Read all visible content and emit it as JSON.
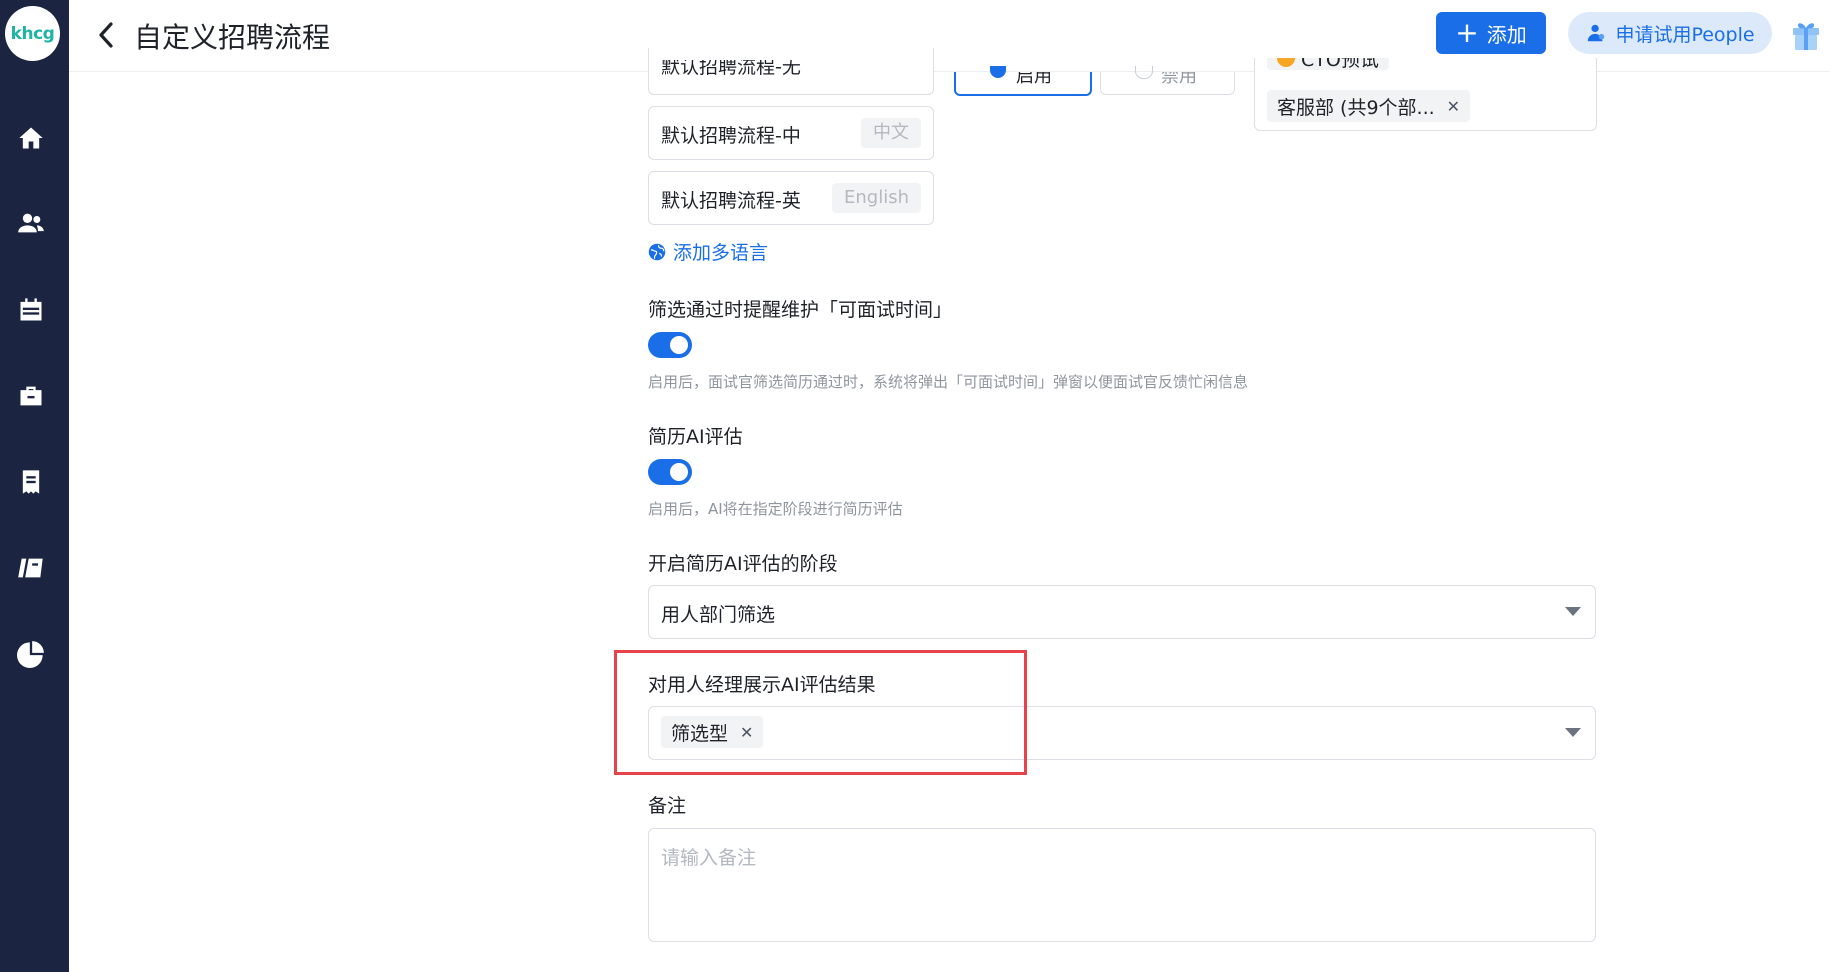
{
  "app": {
    "logo_text": "khcg"
  },
  "sidebar": {
    "items": [
      {
        "name": "home",
        "icon": "home-icon"
      },
      {
        "name": "people",
        "icon": "people-icon"
      },
      {
        "name": "calendar",
        "icon": "calendar-icon"
      },
      {
        "name": "jobs",
        "icon": "briefcase-icon"
      },
      {
        "name": "documents",
        "icon": "document-icon"
      },
      {
        "name": "library",
        "icon": "library-icon"
      },
      {
        "name": "reports",
        "icon": "pie-chart-icon"
      }
    ]
  },
  "header": {
    "title": "自定义招聘流程",
    "add_label": "添加",
    "trial_label": "申请试用People"
  },
  "process": {
    "cut_top_label": "默认招聘流程-无",
    "languages": [
      {
        "name": "默认招聘流程-中",
        "tag": "中文"
      },
      {
        "name": "默认招聘流程-英",
        "tag": "English"
      }
    ],
    "add_language_label": "添加多语言",
    "radio_enabled_label": "启用",
    "radio_disabled_label": "禁用",
    "dept_cut_label": "CTO预试",
    "dept_chip": "客服部 (共9个部..."
  },
  "remind": {
    "label": "筛选通过时提醒维护「可面试时间」",
    "enabled": true,
    "hint": "启用后，面试官筛选简历通过时，系统将弹出「可面试时间」弹窗以便面试官反馈忙闲信息"
  },
  "resume_ai": {
    "label": "简历AI评估",
    "enabled": true,
    "hint": "启用后，AI将在指定阶段进行简历评估"
  },
  "ai_stage": {
    "label": "开启简历AI评估的阶段",
    "value": "用人部门筛选"
  },
  "show_result": {
    "label": "对用人经理展示AI评估结果",
    "chip": "筛选型"
  },
  "remark": {
    "label": "备注",
    "placeholder": "请输入备注"
  },
  "colors": {
    "primary": "#1a6fe8",
    "sidebar": "#1b2440",
    "highlight": "#e8434a"
  }
}
